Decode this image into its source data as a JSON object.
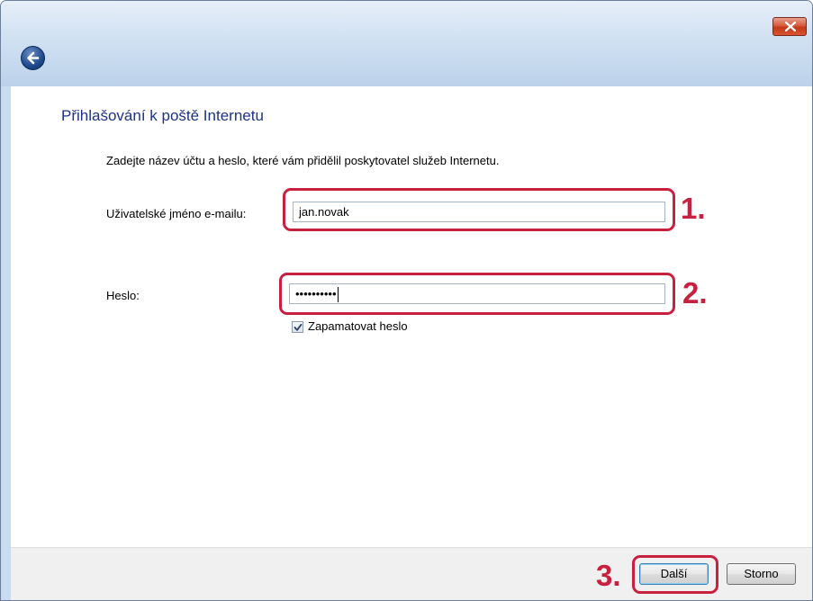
{
  "window": {
    "close_glyph": "×"
  },
  "page": {
    "title": "Přihlašování k poště Internetu",
    "intro": "Zadejte název účtu a heslo, které vám přidělil poskytovatel služeb Internetu."
  },
  "form": {
    "username_label": "Uživatelské jméno e-mailu:",
    "username_value": "jan.novak",
    "password_label": "Heslo:",
    "password_value": "••••••••••",
    "remember_label": "Zapamatovat heslo",
    "remember_checked": true
  },
  "annotations": {
    "step1": "1.",
    "step2": "2.",
    "step3": "3."
  },
  "buttons": {
    "next": "Další",
    "cancel": "Storno"
  },
  "colors": {
    "accent": "#c8213f",
    "title": "#1e3287"
  },
  "icons": {
    "back": "back-arrow-icon",
    "close": "close-icon",
    "check": "checkmark-icon"
  }
}
